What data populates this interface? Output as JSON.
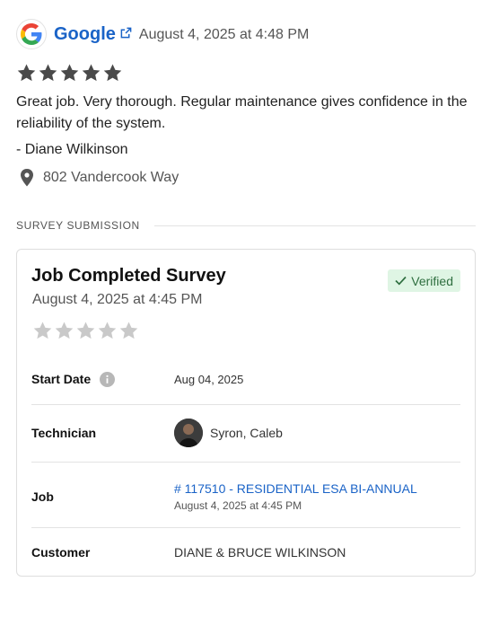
{
  "review": {
    "source": "Google",
    "date": "August 4, 2025 at 4:48 PM",
    "rating": 5,
    "text": "Great job.  Very thorough. Regular maintenance gives confidence in the reliability of the system.",
    "author": "- Diane Wilkinson",
    "address": "802 Vandercook Way"
  },
  "section": {
    "title": "SURVEY SUBMISSION"
  },
  "survey": {
    "title": "Job Completed Survey",
    "date": "August 4, 2025 at 4:45 PM",
    "badge": "Verified",
    "rating": 0,
    "rows": {
      "start_date": {
        "label": "Start Date",
        "value": "Aug 04, 2025"
      },
      "technician": {
        "label": "Technician",
        "value": "Syron, Caleb"
      },
      "job": {
        "label": "Job",
        "value": "# 117510 - RESIDENTIAL ESA BI-ANNUAL",
        "sub": "August 4, 2025 at 4:45 PM"
      },
      "customer": {
        "label": "Customer",
        "value": "DIANE & BRUCE WILKINSON"
      }
    }
  },
  "colors": {
    "link": "#1a63c7",
    "star_filled": "#4a4a4a",
    "star_empty": "#c9c9c9",
    "verified_bg": "#dff5e4",
    "verified_text": "#2e6e3f"
  },
  "icons": {
    "logo": "google-g-icon",
    "external": "external-link-icon",
    "address": "map-pin-icon",
    "verified": "check-icon",
    "info": "info-icon"
  }
}
